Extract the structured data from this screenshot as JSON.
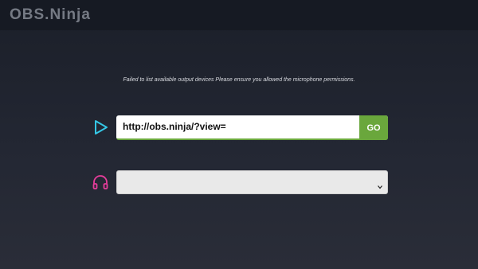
{
  "app": {
    "title": "OBS.Ninja"
  },
  "status": {
    "message": "Failed to list available output devices Please ensure you allowed the microphone permissions."
  },
  "view_input": {
    "value": "http://obs.ninja/?view=",
    "button_label": "GO"
  },
  "audio_output": {
    "selected": ""
  },
  "colors": {
    "accent_green": "#6aa73c",
    "play_icon": "#35c7e6",
    "headphones_icon": "#e63d9b"
  },
  "icons": {
    "play": "play-icon",
    "headphones": "headphones-icon",
    "dropdown": "chevron-down-icon"
  }
}
